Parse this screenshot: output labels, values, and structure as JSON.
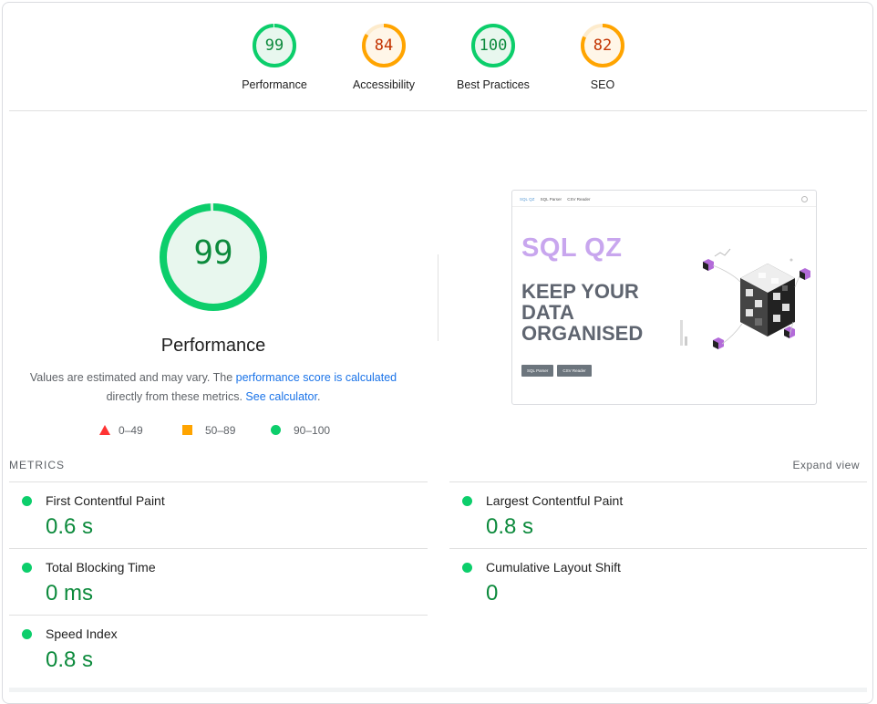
{
  "colors": {
    "pass": "#0cce6b",
    "pass_text": "#0c8a3c",
    "average": "#ffa400",
    "average_text": "#c33300",
    "fail": "#ff3333",
    "link": "#1a73e8"
  },
  "categories": [
    {
      "label": "Performance",
      "score": 99,
      "level": "pass"
    },
    {
      "label": "Accessibility",
      "score": 84,
      "level": "average"
    },
    {
      "label": "Best Practices",
      "score": 100,
      "level": "pass"
    },
    {
      "label": "SEO",
      "score": 82,
      "level": "average"
    }
  ],
  "performance": {
    "score": "99",
    "score_value": 99,
    "title": "Performance",
    "desc_prefix": "Values are estimated and may vary. The ",
    "desc_link1": "performance score is calculated",
    "desc_middle": "directly from these metrics. ",
    "desc_link2": "See calculator",
    "desc_suffix": "."
  },
  "legend": {
    "fail": "0–49",
    "average": "50–89",
    "pass": "90–100"
  },
  "thumbnail": {
    "nav_brand": "SQL QZ",
    "nav_items": [
      "SQL Parser",
      "CSV Reader"
    ],
    "title": "SQL QZ",
    "headline": [
      "KEEP YOUR",
      "DATA",
      "ORGANISED"
    ],
    "buttons": [
      "SQL Parser",
      "CSV Reader"
    ]
  },
  "metrics": {
    "header": "METRICS",
    "expand_label": "Expand view",
    "items": [
      {
        "name": "First Contentful Paint",
        "value": "0.6 s"
      },
      {
        "name": "Largest Contentful Paint",
        "value": "0.8 s"
      },
      {
        "name": "Total Blocking Time",
        "value": "0 ms"
      },
      {
        "name": "Cumulative Layout Shift",
        "value": "0"
      },
      {
        "name": "Speed Index",
        "value": "0.8 s"
      }
    ]
  }
}
